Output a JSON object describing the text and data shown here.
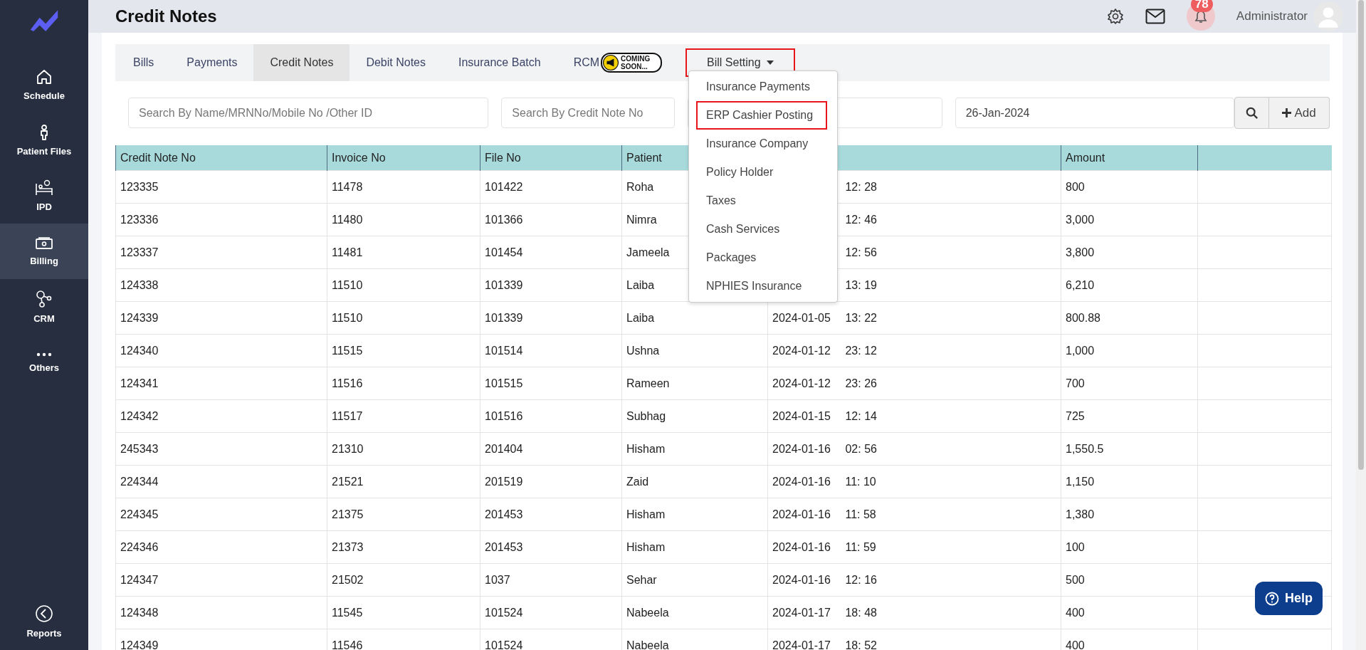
{
  "sidebar": {
    "items": [
      {
        "label": "Schedule",
        "selected": false
      },
      {
        "label": "Patient Files",
        "selected": false
      },
      {
        "label": "IPD",
        "selected": false
      },
      {
        "label": "Billing",
        "selected": true
      },
      {
        "label": "CRM",
        "selected": false
      },
      {
        "label": "Others",
        "selected": false
      }
    ],
    "footer_item": {
      "label": "Reports"
    }
  },
  "header": {
    "title": "Credit Notes",
    "notification_count": "78",
    "user": "Administrator"
  },
  "tabs": [
    {
      "label": "Bills",
      "selected": false
    },
    {
      "label": "Payments",
      "selected": false
    },
    {
      "label": "Credit Notes",
      "selected": true
    },
    {
      "label": "Debit Notes",
      "selected": false
    },
    {
      "label": "Insurance Batch",
      "selected": false
    },
    {
      "label": "RCM",
      "selected": false,
      "badge": "COMING SOON..."
    }
  ],
  "bill_setting": {
    "label": "Bill Setting",
    "highlighted": true,
    "expanded": true,
    "items": [
      {
        "label": "Insurance Payments",
        "highlighted": false
      },
      {
        "label": "ERP Cashier Posting",
        "highlighted": true
      },
      {
        "label": "Insurance Company",
        "highlighted": false
      },
      {
        "label": "Policy Holder",
        "highlighted": false
      },
      {
        "label": "Taxes",
        "highlighted": false
      },
      {
        "label": "Cash Services",
        "highlighted": false
      },
      {
        "label": "Packages",
        "highlighted": false
      },
      {
        "label": "NPHIES Insurance",
        "highlighted": false
      }
    ]
  },
  "filters": {
    "name_search": {
      "placeholder": "Search By Name/MRNNo/Mobile No /Other ID"
    },
    "credit_note_search": {
      "placeholder": "Search By Credit Note No"
    },
    "date": {
      "value": "26-Jan-2024"
    },
    "add_label": "Add"
  },
  "table": {
    "columns": [
      "Credit Note No",
      "Invoice No",
      "File No",
      "Patient"
    ],
    "amount_column": "Amount",
    "rows": [
      {
        "credit_note_no": "123335",
        "invoice_no": "11478",
        "file_no": "101422",
        "patient": "Roha",
        "time": "12: 28",
        "amount": "800"
      },
      {
        "credit_note_no": "123336",
        "invoice_no": "11480",
        "file_no": "101366",
        "patient": "Nimra",
        "time": "12: 46",
        "amount": "3,000"
      },
      {
        "credit_note_no": "123337",
        "invoice_no": "11481",
        "file_no": "101454",
        "patient": "Jameela",
        "time": "12: 56",
        "amount": "3,800"
      },
      {
        "credit_note_no": "124338",
        "invoice_no": "11510",
        "file_no": "101339",
        "patient": "Laiba",
        "time": "13: 19",
        "amount": "6,210"
      },
      {
        "credit_note_no": "124339",
        "invoice_no": "11510",
        "file_no": "101339",
        "patient": "Laiba",
        "date": "2024-01-05",
        "time": "13: 22",
        "amount": "800.88"
      },
      {
        "credit_note_no": "124340",
        "invoice_no": "11515",
        "file_no": "101514",
        "patient": "Ushna",
        "date": "2024-01-12",
        "time": "23: 12",
        "amount": "1,000"
      },
      {
        "credit_note_no": "124341",
        "invoice_no": "11516",
        "file_no": "101515",
        "patient": "Rameen",
        "date": "2024-01-12",
        "time": "23: 26",
        "amount": "700"
      },
      {
        "credit_note_no": "124342",
        "invoice_no": "11517",
        "file_no": "101516",
        "patient": "Subhag",
        "date": "2024-01-15",
        "time": "12: 14",
        "amount": "725"
      },
      {
        "credit_note_no": "245343",
        "invoice_no": "21310",
        "file_no": "201404",
        "patient": "Hisham",
        "date": "2024-01-16",
        "time": "02: 56",
        "amount": "1,550.5"
      },
      {
        "credit_note_no": "224344",
        "invoice_no": "21521",
        "file_no": "201519",
        "patient": "Zaid",
        "date": "2024-01-16",
        "time": "11: 10",
        "amount": "1,150"
      },
      {
        "credit_note_no": "224345",
        "invoice_no": "21375",
        "file_no": "201453",
        "patient": "Hisham",
        "date": "2024-01-16",
        "time": "11: 58",
        "amount": "1,380"
      },
      {
        "credit_note_no": "224346",
        "invoice_no": "21373",
        "file_no": "201453",
        "patient": "Hisham",
        "date": "2024-01-16",
        "time": "11: 59",
        "amount": "100"
      },
      {
        "credit_note_no": "124347",
        "invoice_no": "21502",
        "file_no": "1037",
        "patient": "Sehar",
        "date": "2024-01-16",
        "time": "12: 16",
        "amount": "500"
      },
      {
        "credit_note_no": "124348",
        "invoice_no": "11545",
        "file_no": "101524",
        "patient": "Nabeela",
        "date": "2024-01-17",
        "time": "18: 48",
        "amount": "400"
      },
      {
        "credit_note_no": "124349",
        "invoice_no": "11546",
        "file_no": "101524",
        "patient": "Nabeela",
        "date": "2024-01-17",
        "time": "18: 52",
        "amount": "400"
      }
    ]
  },
  "help_button": {
    "label": "Help"
  }
}
